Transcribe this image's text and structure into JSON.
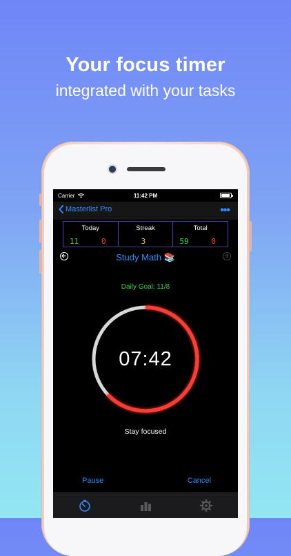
{
  "headline": {
    "title": "Your focus timer",
    "subtitle": "integrated with your tasks"
  },
  "status_bar": {
    "carrier": "Carrier",
    "time": "11:42 PM"
  },
  "nav": {
    "back_label": "Masterlist Pro",
    "more_icon": "ellipsis-icon"
  },
  "stats": {
    "today": {
      "label": "Today",
      "value": "11",
      "secondary": "0"
    },
    "streak": {
      "label": "Streak",
      "value": "3"
    },
    "total": {
      "label": "Total",
      "value": "59",
      "secondary": "0"
    }
  },
  "task": {
    "title": "Study Math 📚"
  },
  "goal": "Daily Goal: 11/8",
  "timer": {
    "display": "07:42",
    "progress": 0.37,
    "remaining_color": "#ff3b30",
    "elapsed_color": "#d8d8d8"
  },
  "message": "Stay focused",
  "actions": {
    "pause": "Pause",
    "cancel": "Cancel"
  },
  "tabs": [
    {
      "icon": "timer-icon",
      "active": true
    },
    {
      "icon": "bar-chart-icon",
      "active": false
    },
    {
      "icon": "gear-icon",
      "active": false
    }
  ],
  "colors": {
    "accent": "#2f8cff",
    "green": "#2ed840",
    "red": "#ff3b30",
    "yellow": "#f3c529"
  }
}
